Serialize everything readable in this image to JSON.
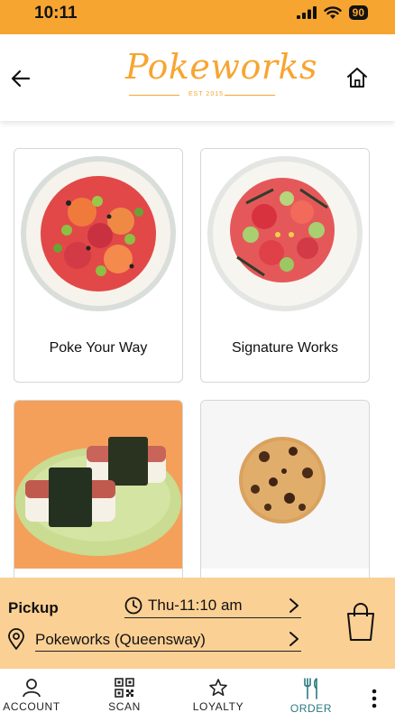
{
  "status_bar": {
    "time": "10:11",
    "battery": "90"
  },
  "header": {
    "logo_text": "Pokeworks",
    "logo_tagline": "EST 2015"
  },
  "menu": {
    "items": [
      {
        "label": "Poke Your Way"
      },
      {
        "label": "Signature Works"
      },
      {
        "label": ""
      },
      {
        "label": ""
      }
    ]
  },
  "pickup": {
    "label": "Pickup",
    "time": "Thu-11:10 am",
    "location": "Pokeworks (Queensway)"
  },
  "bottom_nav": {
    "account": "ACCOUNT",
    "scan": "SCAN",
    "loyalty": "LOYALTY",
    "order": "ORDER"
  },
  "colors": {
    "brand": "#f7a531",
    "pickup_bg": "#fbd094",
    "active_nav": "#2b7a80"
  }
}
